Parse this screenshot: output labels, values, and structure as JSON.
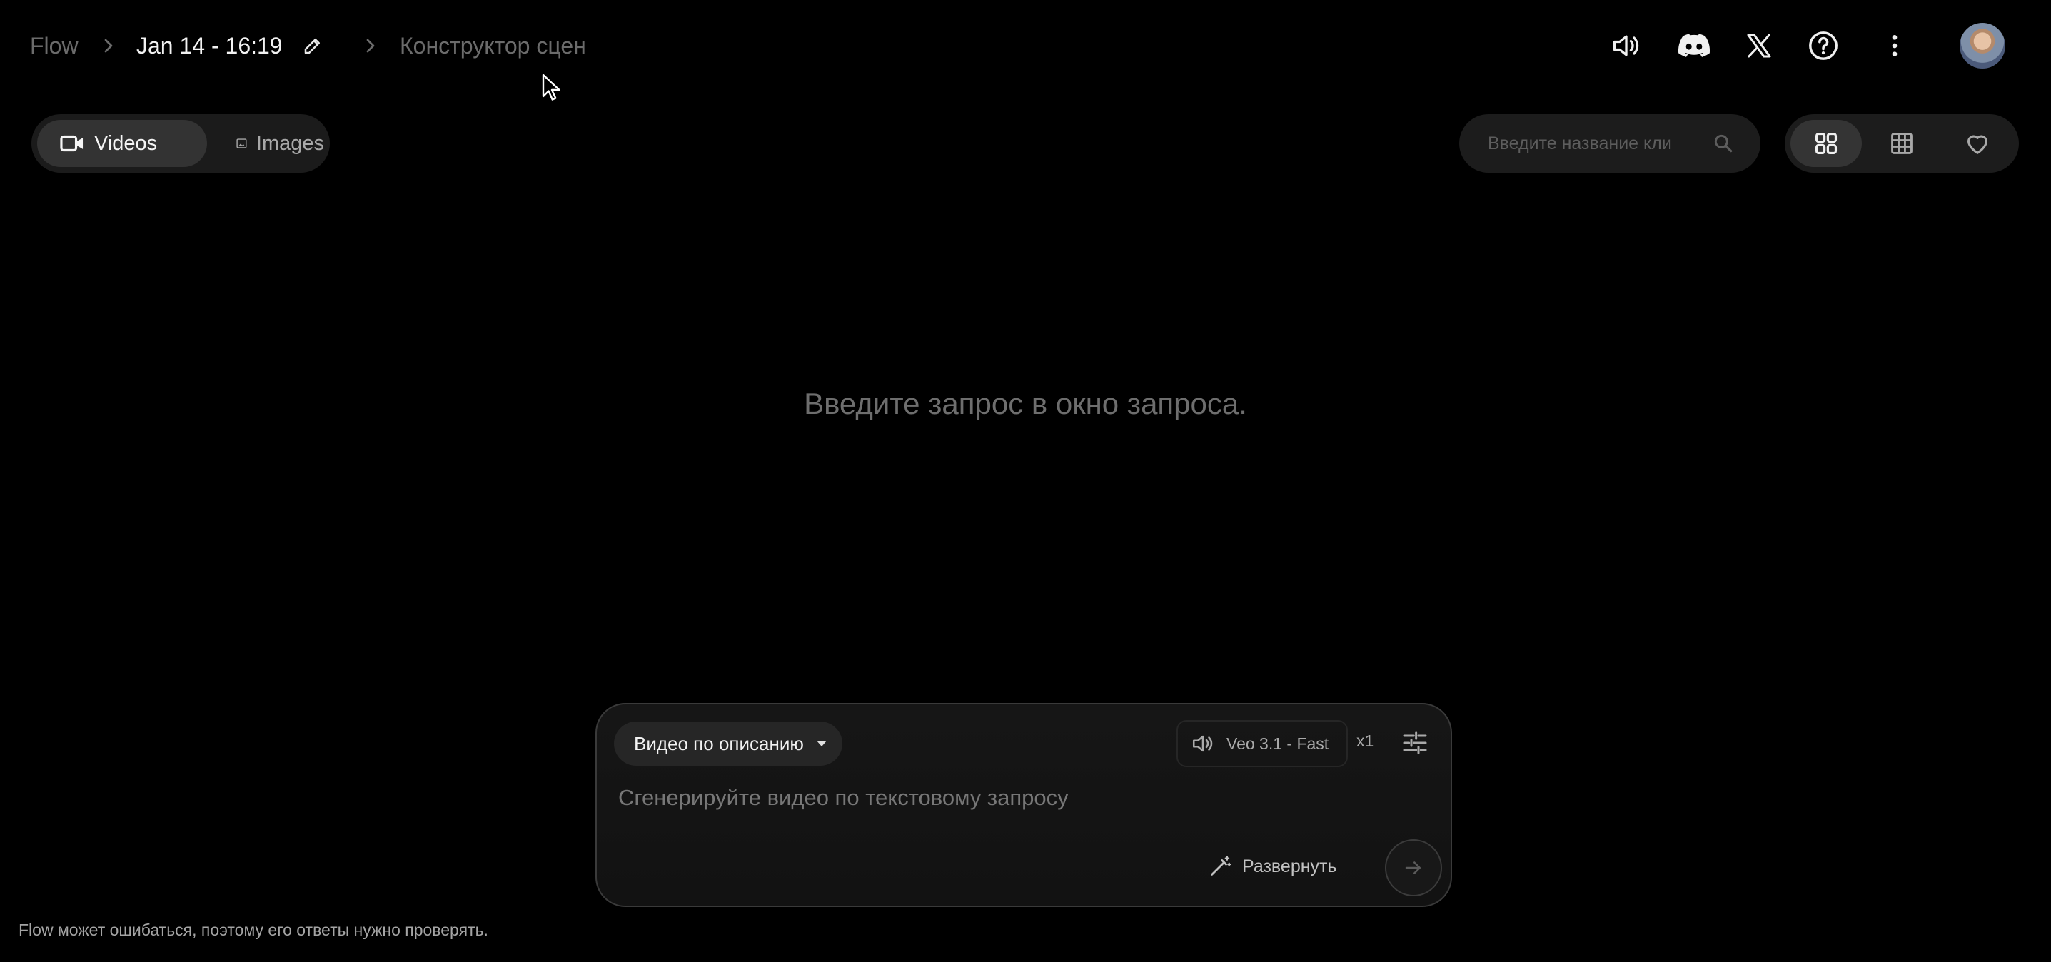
{
  "breadcrumb": {
    "root": "Flow",
    "project_title": "Jan 14 - 16:19",
    "current": "Конструктор сцен"
  },
  "header_icons": {
    "sound": "volume-icon",
    "discord": "discord-icon",
    "x": "x-logo-icon",
    "help": "help-icon",
    "more": "more-vert-icon",
    "avatar": "avatar"
  },
  "tabs": [
    {
      "label": "Videos",
      "icon": "videocam-icon",
      "active": true
    },
    {
      "label": "Images",
      "icon": "image-icon",
      "active": false
    }
  ],
  "search": {
    "placeholder": "Введите название кли",
    "value": ""
  },
  "view_toggles": [
    {
      "name": "grid-view",
      "icon": "grid-2x2-icon",
      "active": true
    },
    {
      "name": "table-view",
      "icon": "grid-3x3-icon",
      "active": false
    },
    {
      "name": "favorites-view",
      "icon": "heart-icon",
      "active": false
    }
  ],
  "empty_state": "Введите запрос в окно запроса.",
  "composer": {
    "mode_label": "Видео по описанию",
    "model_label": "Veo 3.1 - Fast",
    "count_label": "x1",
    "prompt_placeholder": "Сгенерируйте видео по текстовому запросу",
    "prompt_value": "",
    "expand_label": "Развернуть"
  },
  "disclaimer": "Flow может ошибаться, поэтому его ответы нужно проверять.",
  "colors": {
    "background": "#000000",
    "surface": "#1c1c1c",
    "active_surface": "#343434",
    "text_primary": "#f2f2f2",
    "text_muted": "#6b6b6b"
  }
}
